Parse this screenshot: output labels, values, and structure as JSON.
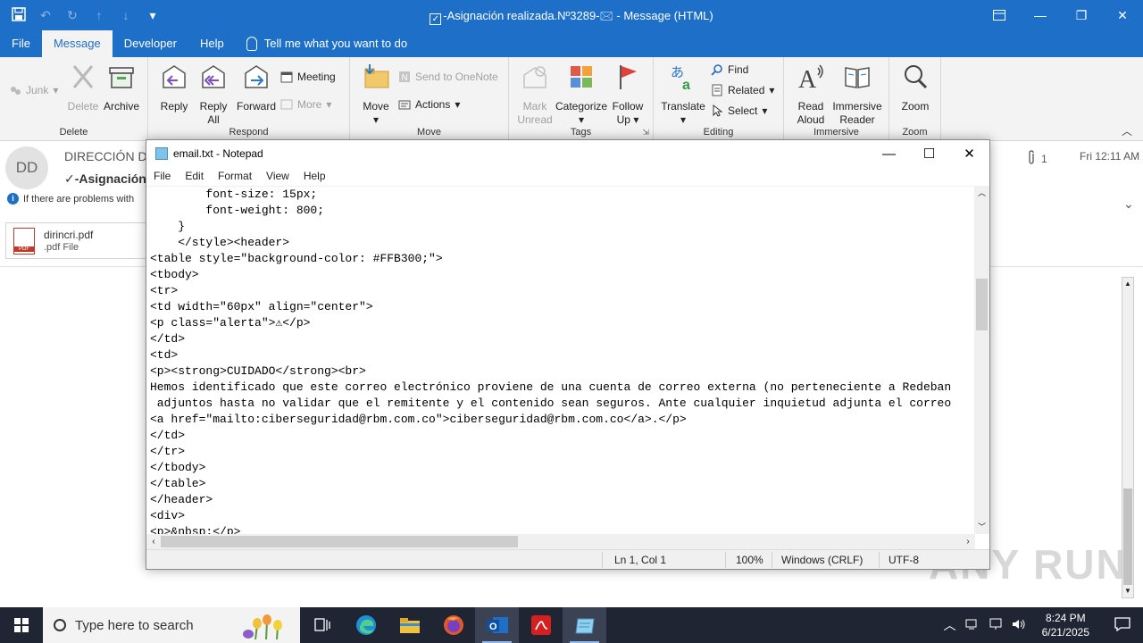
{
  "outlook": {
    "window_title": "-Asignación realizada.Nº3289-🖂 - Message (HTML)",
    "tabs": [
      "File",
      "Message",
      "Developer",
      "Help"
    ],
    "active_tab": "Message",
    "tell_me": "Tell me what you want to do",
    "ribbon": {
      "delete_group": {
        "label": "Delete",
        "junk": "Junk",
        "delete": "Delete",
        "archive": "Archive"
      },
      "respond_group": {
        "label": "Respond",
        "reply": "Reply",
        "reply_all_1": "Reply",
        "reply_all_2": "All",
        "forward": "Forward",
        "meeting": "Meeting",
        "more": "More"
      },
      "move_group": {
        "label": "Move",
        "move": "Move",
        "send_onenote": "Send to OneNote",
        "actions": "Actions"
      },
      "tags_group": {
        "label": "Tags",
        "mark_1": "Mark",
        "mark_2": "Unread",
        "categorize": "Categorize",
        "follow_1": "Follow",
        "follow_2": "Up"
      },
      "editing_group": {
        "label": "Editing",
        "translate": "Translate",
        "find": "Find",
        "related": "Related",
        "select": "Select"
      },
      "immersive_group": {
        "label": "Immersive",
        "read_1": "Read",
        "read_2": "Aloud",
        "immersive_1": "Immersive",
        "immersive_2": "Reader"
      },
      "zoom_group": {
        "label": "Zoom",
        "zoom": "Zoom"
      }
    },
    "message": {
      "avatar_initials": "DD",
      "sender": "DIRECCIÓN D",
      "subject": "✓-Asignación",
      "info": "If there are problems with",
      "attachment_name": "dirincri.pdf",
      "attachment_type": ".pdf File",
      "attachment_count": "1",
      "date": "Fri 12:11 AM"
    }
  },
  "notepad": {
    "title": "email.txt - Notepad",
    "menu": [
      "File",
      "Edit",
      "Format",
      "View",
      "Help"
    ],
    "content": "        font-size: 15px;\n        font-weight: 800;\n    }\n    </style><header>\n<table style=\"background-color: #FFB300;\">\n<tbody>\n<tr>\n<td width=\"60px\" align=\"center\">\n<p class=\"alerta\">⚠</p>\n</td>\n<td>\n<p><strong>CUIDADO</strong><br>\nHemos identificado que este correo electrónico proviene de una cuenta de correo externa (no perteneciente a Redeban\n adjuntos hasta no validar que el remitente y el contenido sean seguros. Ante cualquier inquietud adjunta el correo\n<a href=\"mailto:ciberseguridad@rbm.com.co\">ciberseguridad@rbm.com.co</a>.</p>\n</td>\n</tr>\n</tbody>\n</table>\n</header>\n<div>\n<p>&nbsp;</p>",
    "status": {
      "position": "Ln 1, Col 1",
      "zoom": "100%",
      "line_ending": "Windows (CRLF)",
      "encoding": "UTF-8"
    }
  },
  "taskbar": {
    "search_placeholder": "Type here to search",
    "time": "8:24 PM",
    "date": "6/21/2025"
  },
  "watermark": "ANY RUN",
  "colors": {
    "accent": "#1e6fc8",
    "taskbar": "#1f2532"
  }
}
